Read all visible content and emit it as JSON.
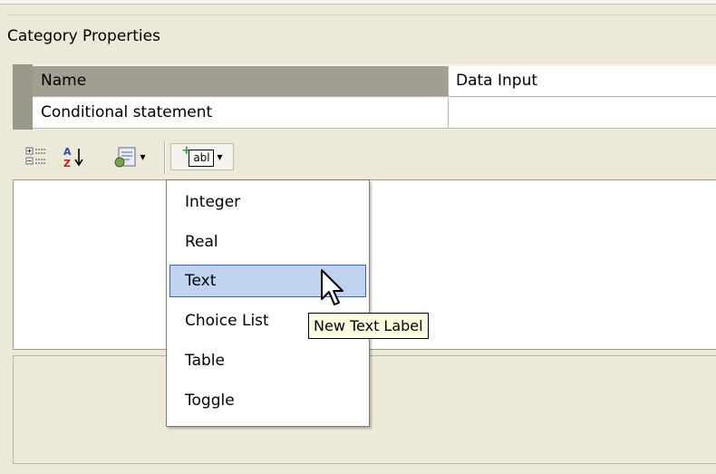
{
  "panel": {
    "title": "Category Properties"
  },
  "properties": [
    {
      "name": "Name",
      "value": "Data Input",
      "selected": true
    },
    {
      "name": "Conditional statement",
      "value": "",
      "selected": false
    }
  ],
  "toolbar": {
    "categorized_icon": "categorized-icon",
    "alphabetical_icon": "sort-az-icon",
    "property_pages_icon": "property-pages-icon",
    "add_label_icon": "add-label-icon",
    "add_label_glyph": "abl",
    "dropdown_arrow": "▾"
  },
  "dropdown_menu": {
    "items": [
      "Integer",
      "Real",
      "Text",
      "Choice List",
      "Table",
      "Toggle"
    ],
    "hovered_item": "Text"
  },
  "tooltip": {
    "text": "New Text Label"
  },
  "colors": {
    "selection_fill": "#c1d2ee",
    "selection_border": "#316ac5",
    "tooltip_bg": "#ffffe1",
    "window_bg": "#ece9d8"
  }
}
